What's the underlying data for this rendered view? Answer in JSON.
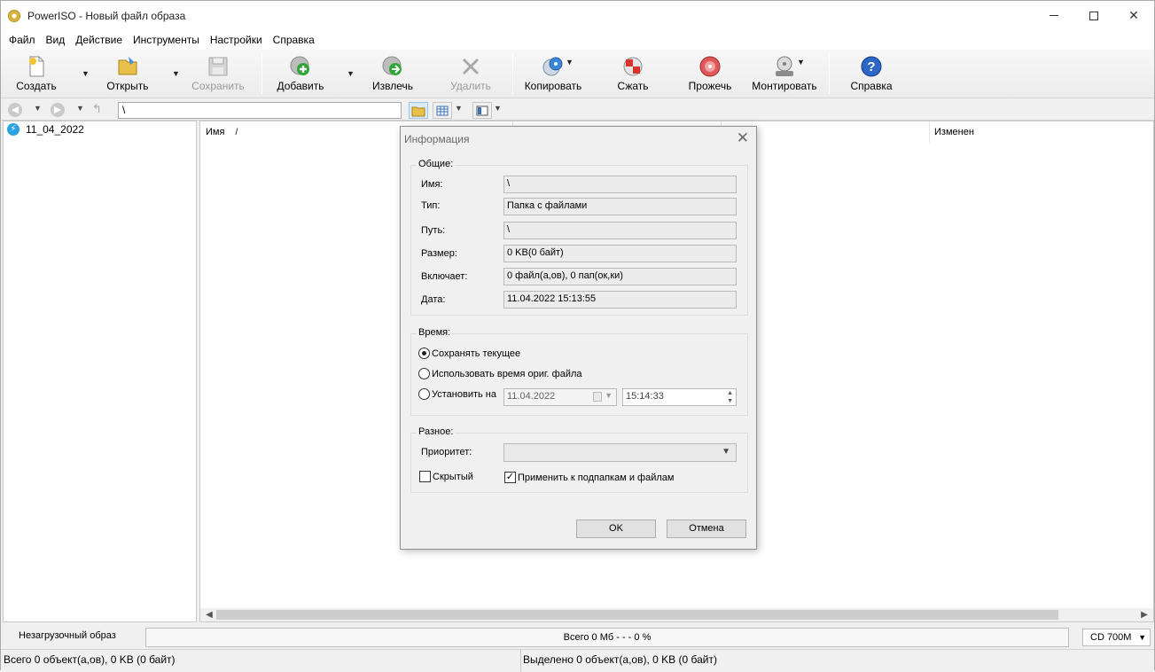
{
  "window": {
    "title": "PowerISO - Новый файл образа"
  },
  "menu": [
    "Файл",
    "Вид",
    "Действие",
    "Инструменты",
    "Настройки",
    "Справка"
  ],
  "toolbar": {
    "create": "Создать",
    "open": "Открыть",
    "save": "Сохранить",
    "add": "Добавить",
    "extract": "Извлечь",
    "delete": "Удалить",
    "copy": "Копировать",
    "compress": "Сжать",
    "burn": "Прожечь",
    "mount": "Монтировать",
    "help": "Справка"
  },
  "address": {
    "path": "\\"
  },
  "tree": {
    "item": "11_04_2022"
  },
  "list": {
    "col_name": "Имя",
    "col_modified": "Изменен"
  },
  "status": {
    "boot": "Незагрузочный образ",
    "total": "Всего  0 Мб   - - -  0 %",
    "media": "CD 700M",
    "left": "Всего 0 объект(а,ов), 0 KB (0 байт)",
    "right": "Выделено 0 объект(а,ов), 0 KB (0 байт)"
  },
  "dialog": {
    "title": "Информация",
    "general_group": "Общие:",
    "name_label": "Имя:",
    "name_value": "\\",
    "type_label": "Тип:",
    "type_value": "Папка с файлами",
    "path_label": "Путь:",
    "path_value": "\\",
    "size_label": "Размер:",
    "size_value": "0 KB(0 байт)",
    "contains_label": "Включает:",
    "contains_value": "0 файл(а,ов), 0 пап(ок,ки)",
    "date_label": "Дата:",
    "date_value": "11.04.2022 15:13:55",
    "time_group": "Время:",
    "keep_current": "Сохранять текущее",
    "use_original": "Использовать время ориг. файла",
    "set_to": "Установить на",
    "set_date": "11.04.2022",
    "set_time": "15:14:33",
    "misc_group": "Разное:",
    "priority_label": "Приоритет:",
    "hidden": "Скрытый",
    "apply_sub": "Применить к подпапкам и файлам",
    "ok": "OK",
    "cancel": "Отмена"
  }
}
